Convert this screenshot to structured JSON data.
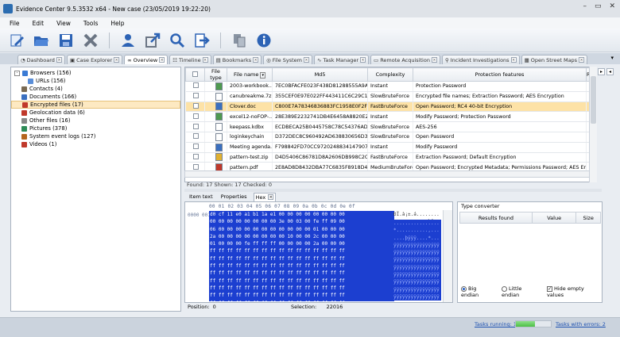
{
  "window": {
    "title": "Evidence Center 9.5.3532 x64 - New case (23/05/2019 19:22:20)"
  },
  "menu": [
    "File",
    "Edit",
    "View",
    "Tools",
    "Help"
  ],
  "toolbar_icons": [
    "edit-icon",
    "open-folder-icon",
    "save-icon",
    "delete-icon",
    "user-icon",
    "export-icon",
    "search-icon",
    "import-icon",
    "copy-icon",
    "info-icon"
  ],
  "tabs": [
    {
      "label": "Dashboard"
    },
    {
      "label": "Case Explorer"
    },
    {
      "label": "Overview",
      "active": true
    },
    {
      "label": "Timeline"
    },
    {
      "label": "Bookmarks"
    },
    {
      "label": "File System"
    },
    {
      "label": "Task Manager"
    },
    {
      "label": "Remote Acquisition"
    },
    {
      "label": "Incident Investigations"
    },
    {
      "label": "Open Street Maps"
    }
  ],
  "tree": [
    {
      "label": "Browsers (156)",
      "indent": 0,
      "expander": "-",
      "icon_color": "#3a7bd5"
    },
    {
      "label": "URLs (156)",
      "indent": 1,
      "icon_color": "#5a8ed8"
    },
    {
      "label": "Contacts (4)",
      "indent": 0,
      "icon_color": "#7a6a52"
    },
    {
      "label": "Documents (166)",
      "indent": 0,
      "icon_color": "#3a6fbf"
    },
    {
      "label": "Encrypted files (17)",
      "indent": 0,
      "selected": true,
      "icon_color": "#c0392b"
    },
    {
      "label": "Geolocation data (6)",
      "indent": 0,
      "icon_color": "#c0392b"
    },
    {
      "label": "Other files (16)",
      "indent": 0,
      "icon_color": "#888888"
    },
    {
      "label": "Pictures (378)",
      "indent": 0,
      "icon_color": "#2e8b57"
    },
    {
      "label": "System event logs (127)",
      "indent": 0,
      "icon_color": "#b5651d"
    },
    {
      "label": "Videos (1)",
      "indent": 0,
      "icon_color": "#c0392b"
    }
  ],
  "grid": {
    "columns": [
      "",
      "File type",
      "File name",
      "Md5",
      "Complexity",
      "Protection features",
      "R"
    ],
    "rows": [
      {
        "name": "2003-workbook...",
        "md5": "7EC0BFACFE023F438D81288555A9ACB0",
        "complexity": "Instant",
        "features": "Protection Password",
        "r": "F",
        "icon": "#4f9a4f"
      },
      {
        "name": "canubreakme.7z",
        "md5": "355CEF0E97E022FF443411C6C29C1A14D",
        "complexity": "SlowBruteForce",
        "features": "Encrypted file names; Extraction Password; AES Encryption",
        "r": "F",
        "icon": "#ffffff"
      },
      {
        "name": "Clover.doc",
        "md5": "C800E7A78346836883FC1958E0F2F149",
        "complexity": "FastBruteForce",
        "features": "Open Password; RC4 40-bit Encryption",
        "r": "F",
        "icon": "#3a6fbf",
        "selected": true
      },
      {
        "name": "excel12-noFOP-...",
        "md5": "28E389E2232741DB4E6458A8820E2786",
        "complexity": "Instant",
        "features": "Modify Password; Protection Password",
        "r": "F",
        "icon": "#4f9a4f"
      },
      {
        "name": "keepass.kdbx",
        "md5": "ECDBECA25B0445758C78C54376AD441C",
        "complexity": "SlowBruteForce",
        "features": "AES-256",
        "r": "F",
        "icon": "#ffffff"
      },
      {
        "name": "loginkeychain",
        "md5": "D372DEC8C960492AD638830656D3E1A",
        "complexity": "SlowBruteForce",
        "features": "Open Password",
        "r": "F",
        "icon": "#ffffff"
      },
      {
        "name": "Meeting agenda...",
        "md5": "F798842FD70CC9720248834147907F6F",
        "complexity": "Instant",
        "features": "Modify Password",
        "r": "F",
        "icon": "#3a6fbf"
      },
      {
        "name": "pattern-test.zip",
        "md5": "D4D5406C86781D8A2606DB998C2CCFF",
        "complexity": "FastBruteForce",
        "features": "Extraction Password; Default Encryption",
        "r": "I",
        "icon": "#e0b030"
      },
      {
        "name": "pattern.pdf",
        "md5": "2E8AD8D8432DBA77C6835F8918D40551",
        "complexity": "MediumBruteForce",
        "features": "Open Password; Encrypted Metadata; Permissions Password; AES Encryption",
        "r": "F",
        "icon": "#c0392b"
      }
    ]
  },
  "grid_status": "Found: 17   Shown: 17   Checked: 0",
  "subtabs": [
    {
      "label": "Item text"
    },
    {
      "label": "Properties"
    },
    {
      "label": "Hex",
      "active": true
    }
  ],
  "hex": {
    "header": "00 01 02 03 04 05 06 07 08 09 0a 0b 0c 0d 0e 0f",
    "offsets": [
      "0000",
      "0010",
      "0020",
      "0030",
      "0040",
      "0050",
      "0060",
      "0070",
      "0080",
      "0090",
      "00a0",
      "00b0",
      "00c0"
    ],
    "lines": [
      "d0 cf 11 e0 a1 b1 1a e1 00 00 00 00 00 00 00 00",
      "00 00 00 00 00 00 00 00 3e 00 03 00 fe ff 09 00",
      "06 00 00 00 00 00 00 00 00 00 00 00 01 00 00 00",
      "2a 00 00 00 00 00 00 00 00 10 00 00 2c 00 00 00",
      "01 00 00 00 fe ff ff ff 00 00 00 00 2a 00 00 00",
      "ff ff ff ff ff ff ff ff ff ff ff ff ff ff ff ff",
      "ff ff ff ff ff ff ff ff ff ff ff ff ff ff ff ff",
      "ff ff ff ff ff ff ff ff ff ff ff ff ff ff ff ff",
      "ff ff ff ff ff ff ff ff ff ff ff ff ff ff ff ff",
      "ff ff ff ff ff ff ff ff ff ff ff ff ff ff ff ff",
      "ff ff ff ff ff ff ff ff ff ff ff ff ff ff ff ff",
      "ff ff ff ff ff ff ff ff ff ff ff ff ff ff ff ff",
      "ff ff ff ff ff ff ff ff ff ff ff ff ff ff ff ff"
    ],
    "ascii_top": [
      "ÐÏ.à¡±.á........",
      "........>...þÿ.."
    ],
    "ascii_rest": [
      "................",
      "*...........,...",
      "....þÿÿÿ....*...",
      "ÿÿÿÿÿÿÿÿÿÿÿÿÿÿÿÿ",
      "ÿÿÿÿÿÿÿÿÿÿÿÿÿÿÿÿ",
      "ÿÿÿÿÿÿÿÿÿÿÿÿÿÿÿÿ",
      "ÿÿÿÿÿÿÿÿÿÿÿÿÿÿÿÿ",
      "ÿÿÿÿÿÿÿÿÿÿÿÿÿÿÿÿ",
      "ÿÿÿÿÿÿÿÿÿÿÿÿÿÿÿÿ",
      "ÿÿÿÿÿÿÿÿÿÿÿÿÿÿÿÿ",
      "ÿÿÿÿÿÿÿÿÿÿÿÿÿÿÿÿ"
    ]
  },
  "converter": {
    "title": "Type converter",
    "columns": [
      "Results found",
      "Value",
      "Size"
    ],
    "big_endian": "Big endian",
    "little_endian": "Little endian",
    "hide_empty": "Hide empty values"
  },
  "position": {
    "label": "Position:",
    "value": "0",
    "selection_label": "Selection:",
    "selection_value": "22016"
  },
  "status": {
    "tasks": "Tasks running: 1",
    "errors": "Tasks with errors: 2",
    "progress": 0.55
  }
}
